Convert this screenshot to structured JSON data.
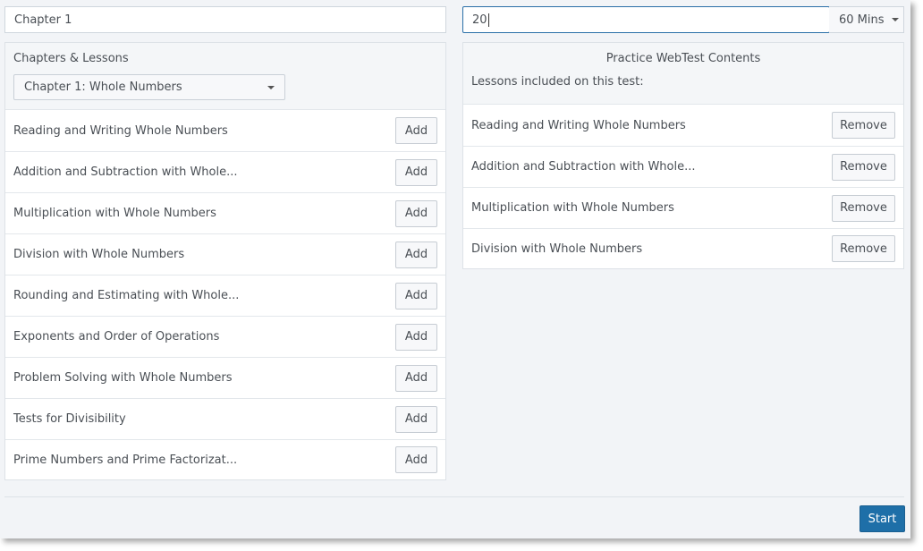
{
  "header": {
    "name_value": "Chapter 1",
    "minutes_value": "20",
    "duration_label": "60 Mins"
  },
  "left_panel": {
    "title": "Chapters & Lessons",
    "chapter_select": "Chapter 1: Whole Numbers",
    "add_label": "Add",
    "lessons": [
      "Reading and Writing Whole Numbers",
      "Addition and Subtraction with Whole...",
      "Multiplication with Whole Numbers",
      "Division with Whole Numbers",
      "Rounding and Estimating with Whole...",
      "Exponents and Order of Operations",
      "Problem Solving with Whole Numbers",
      "Tests for Divisibility",
      "Prime Numbers and Prime Factorizat..."
    ]
  },
  "right_panel": {
    "title": "Practice WebTest Contents",
    "subtitle": "Lessons included on this test:",
    "remove_label": "Remove",
    "lessons": [
      "Reading and Writing Whole Numbers",
      "Addition and Subtraction with Whole...",
      "Multiplication with Whole Numbers",
      "Division with Whole Numbers"
    ]
  },
  "footer": {
    "start_label": "Start"
  },
  "colors": {
    "accent": "#1e6fa8",
    "background": "#f2f4f7"
  }
}
